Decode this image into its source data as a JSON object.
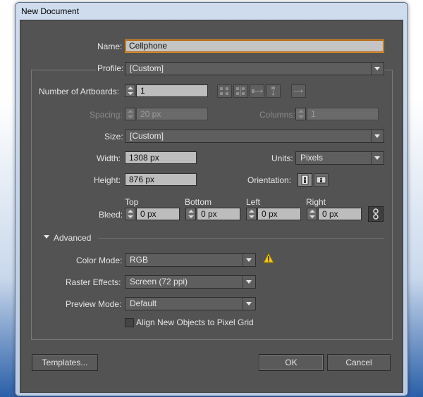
{
  "window": {
    "title": "New Document"
  },
  "name": {
    "label": "Name:",
    "value": "Cellphone"
  },
  "profile": {
    "label": "Profile:",
    "value": "[Custom]"
  },
  "artboards": {
    "label": "Number of Artboards:",
    "value": "1"
  },
  "spacing": {
    "label": "Spacing:",
    "value": "20 px"
  },
  "columns": {
    "label": "Columns:",
    "value": "1"
  },
  "size": {
    "label": "Size:",
    "value": "[Custom]"
  },
  "width": {
    "label": "Width:",
    "value": "1308 px"
  },
  "units": {
    "label": "Units:",
    "value": "Pixels"
  },
  "height": {
    "label": "Height:",
    "value": "876 px"
  },
  "orientation": {
    "label": "Orientation:"
  },
  "bleed": {
    "label": "Bleed:",
    "top_label": "Top",
    "top_value": "0 px",
    "bottom_label": "Bottom",
    "bottom_value": "0 px",
    "left_label": "Left",
    "left_value": "0 px",
    "right_label": "Right",
    "right_value": "0 px"
  },
  "advanced": {
    "label": "Advanced",
    "color_mode": {
      "label": "Color Mode:",
      "value": "RGB"
    },
    "raster_effects": {
      "label": "Raster Effects:",
      "value": "Screen (72 ppi)"
    },
    "preview_mode": {
      "label": "Preview Mode:",
      "value": "Default"
    },
    "align_pixel_grid": {
      "label": "Align New Objects to Pixel Grid",
      "checked": false
    }
  },
  "buttons": {
    "templates": "Templates...",
    "ok": "OK",
    "cancel": "Cancel"
  },
  "icons": [
    "grid-by-row-icon",
    "grid-by-column-icon",
    "arrange-by-row-icon",
    "arrange-by-column-icon",
    "right-to-left-icon",
    "portrait-icon",
    "landscape-icon",
    "link-bleed-icon",
    "warning-icon",
    "disclosure-triangle-icon"
  ]
}
